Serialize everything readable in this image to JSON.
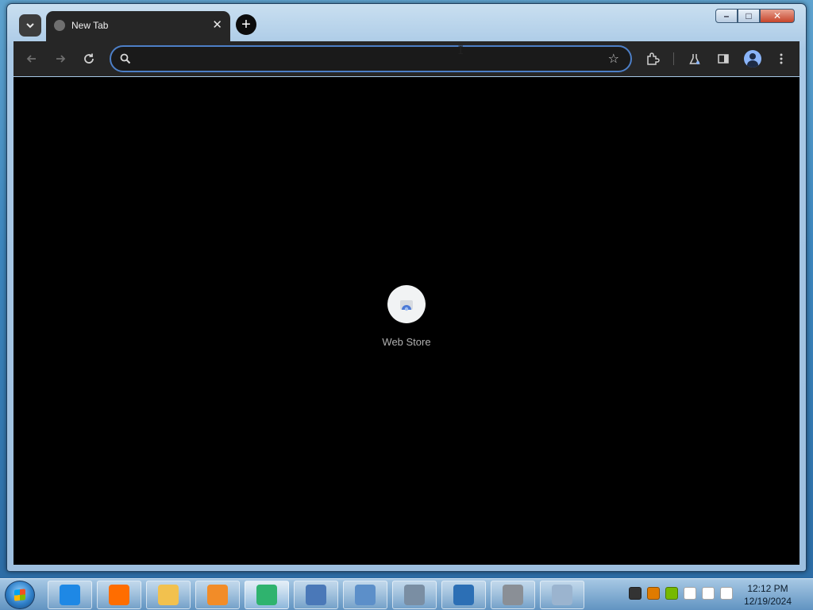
{
  "browser": {
    "tab": {
      "title": "New Tab"
    },
    "new_tab_symbol": "+",
    "close_symbol": "✕",
    "omnibox": {
      "value": "",
      "placeholder": ""
    }
  },
  "content": {
    "shortcuts": [
      {
        "label": "Web Store"
      }
    ]
  },
  "window_controls": {
    "minimize": "–",
    "maximize": "□",
    "close": "✕"
  },
  "taskbar": {
    "apps": [
      {
        "name": "internet-explorer-icon",
        "color": "#1e88e5",
        "active": false
      },
      {
        "name": "firefox-icon",
        "color": "#ff6d00",
        "active": false
      },
      {
        "name": "file-explorer-icon",
        "color": "#f2c14e",
        "active": false
      },
      {
        "name": "media-player-icon",
        "color": "#f28c28",
        "active": false
      },
      {
        "name": "chrome-like-app-icon",
        "color": "#2fb36e",
        "active": true
      },
      {
        "name": "computer-management-icon",
        "color": "#4a78b8",
        "active": false
      },
      {
        "name": "control-panel-icon",
        "color": "#5c8fc9",
        "active": false
      },
      {
        "name": "network-printer-icon",
        "color": "#7a8ea3",
        "active": false
      },
      {
        "name": "powershell-shield-icon",
        "color": "#2c6fb5",
        "active": false
      },
      {
        "name": "server-manager-icon",
        "color": "#8a8f96",
        "active": false
      },
      {
        "name": "disc-utility-icon",
        "color": "#9bb4cf",
        "active": false
      }
    ],
    "tray": [
      {
        "name": "camera-tray-icon",
        "color": "#333333"
      },
      {
        "name": "search-tray-icon",
        "color": "#e07b00"
      },
      {
        "name": "nvidia-tray-icon",
        "color": "#76b900"
      },
      {
        "name": "network-tray-icon",
        "color": "#ffffff"
      },
      {
        "name": "flag-tray-icon",
        "color": "#ffffff"
      },
      {
        "name": "volume-muted-tray-icon",
        "color": "#ffffff"
      }
    ],
    "clock": {
      "time": "12:12 PM",
      "date": "12/19/2024"
    }
  },
  "colors": {
    "accent": "#4d7fc7",
    "toolbar_bg": "#262626",
    "content_bg": "#000000"
  }
}
